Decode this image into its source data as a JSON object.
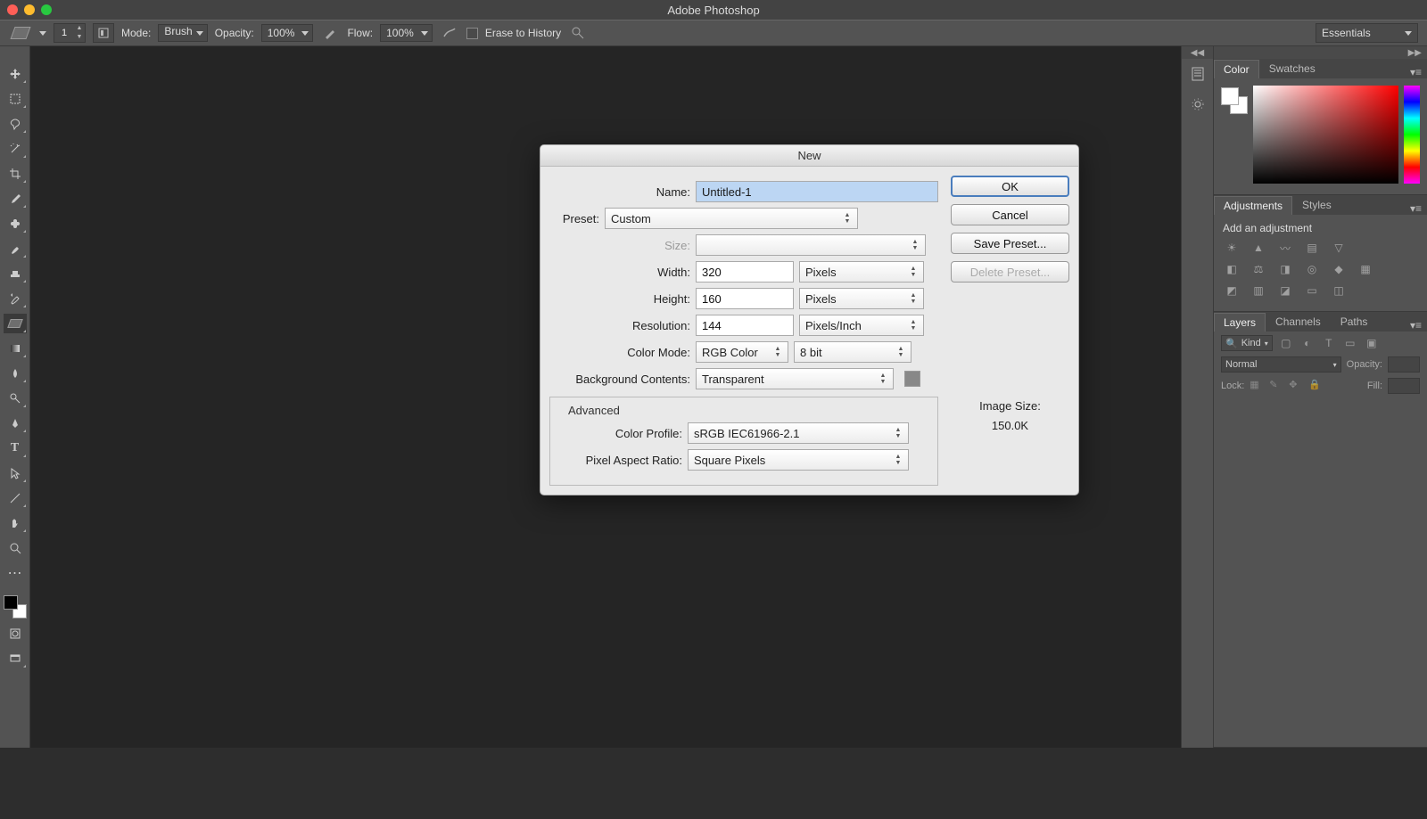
{
  "app": {
    "title": "Adobe Photoshop"
  },
  "optionsbar": {
    "brush_size": "1",
    "mode_label": "Mode:",
    "mode_value": "Brush",
    "opacity_label": "Opacity:",
    "opacity_value": "100%",
    "flow_label": "Flow:",
    "flow_value": "100%",
    "erase_label": "Erase to History",
    "workspace": "Essentials"
  },
  "dialog": {
    "title": "New",
    "name_label": "Name:",
    "name_value": "Untitled-1",
    "preset_label": "Preset:",
    "preset_value": "Custom",
    "size_label": "Size:",
    "size_value": "",
    "width_label": "Width:",
    "width_value": "320",
    "width_unit": "Pixels",
    "height_label": "Height:",
    "height_value": "160",
    "height_unit": "Pixels",
    "res_label": "Resolution:",
    "res_value": "144",
    "res_unit": "Pixels/Inch",
    "mode_label": "Color Mode:",
    "mode_value": "RGB Color",
    "depth_value": "8 bit",
    "bg_label": "Background Contents:",
    "bg_value": "Transparent",
    "advanced_label": "Advanced",
    "profile_label": "Color Profile:",
    "profile_value": "sRGB IEC61966-2.1",
    "pixel_ratio_label": "Pixel Aspect Ratio:",
    "pixel_ratio_value": "Square Pixels",
    "ok": "OK",
    "cancel": "Cancel",
    "save_preset": "Save Preset...",
    "delete_preset": "Delete Preset...",
    "imgsize_label": "Image Size:",
    "imgsize_value": "150.0K"
  },
  "panels": {
    "color_tab": "Color",
    "swatches_tab": "Swatches",
    "adjust_tab": "Adjustments",
    "styles_tab": "Styles",
    "adjust_hint": "Add an adjustment",
    "layers_tab": "Layers",
    "channels_tab": "Channels",
    "paths_tab": "Paths",
    "kind_label": "Kind",
    "blend": "Normal",
    "opacity_label": "Opacity:",
    "lock_label": "Lock:",
    "fill_label": "Fill:"
  }
}
